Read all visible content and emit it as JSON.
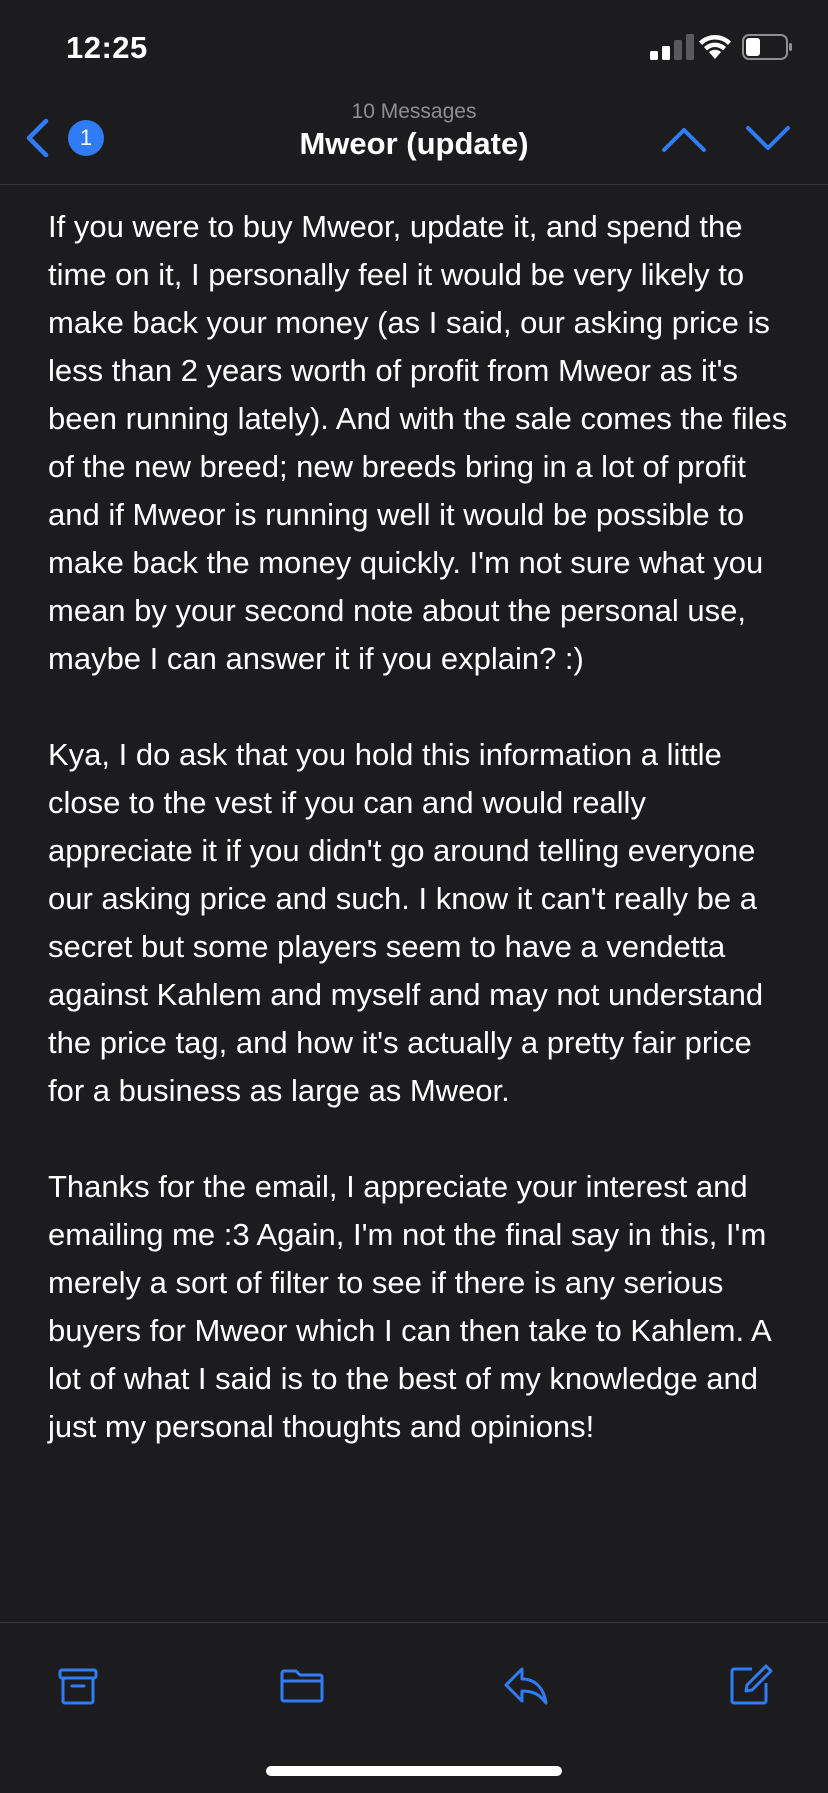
{
  "status_bar": {
    "time": "12:25",
    "signal_icon": "signal-bars-icon",
    "wifi_icon": "wifi-icon",
    "battery_icon": "battery-icon"
  },
  "nav": {
    "back_icon": "chevron-left-icon",
    "unread_count": "1",
    "message_count": "10 Messages",
    "title": "Mweor (update)",
    "prev_icon": "chevron-up-icon",
    "next_icon": "chevron-down-icon"
  },
  "message": {
    "paragraphs": [
      "If you were to buy Mweor, update it, and spend the time on it, I personally feel it would be very likely to make back your money (as I said, our asking price is less than 2 years worth of profit from Mweor as it's been running lately). And with the sale comes the files of the new breed; new breeds bring in a lot of profit and if Mweor is running well it would be possible to make back the money quickly. I'm not sure what you mean by your second note about the personal use, maybe I can answer it if you explain? :)",
      "Kya, I do ask that you hold this information a little close to the vest if you can and would really appreciate it if you didn't go around telling everyone our asking price and such. I know it can't really be a secret but some players seem to have a vendetta against Kahlem and myself and may not understand the price tag, and how it's actually a pretty fair price for a business as large as Mweor.",
      "Thanks for the email, I appreciate your interest and emailing me :3 Again, I'm not the final say in this, I'm merely a sort of filter to see if there is any serious buyers for Mweor which I can then take to Kahlem. A lot of what I said is to the best of my knowledge and just my personal thoughts and opinions!"
    ]
  },
  "toolbar": {
    "archive_icon": "archive-icon",
    "move_icon": "folder-icon",
    "reply_icon": "reply-icon",
    "compose_icon": "compose-icon"
  },
  "colors": {
    "background": "#1c1c1e",
    "accent": "#2f7cf6",
    "secondary_text": "#8e8e93"
  }
}
